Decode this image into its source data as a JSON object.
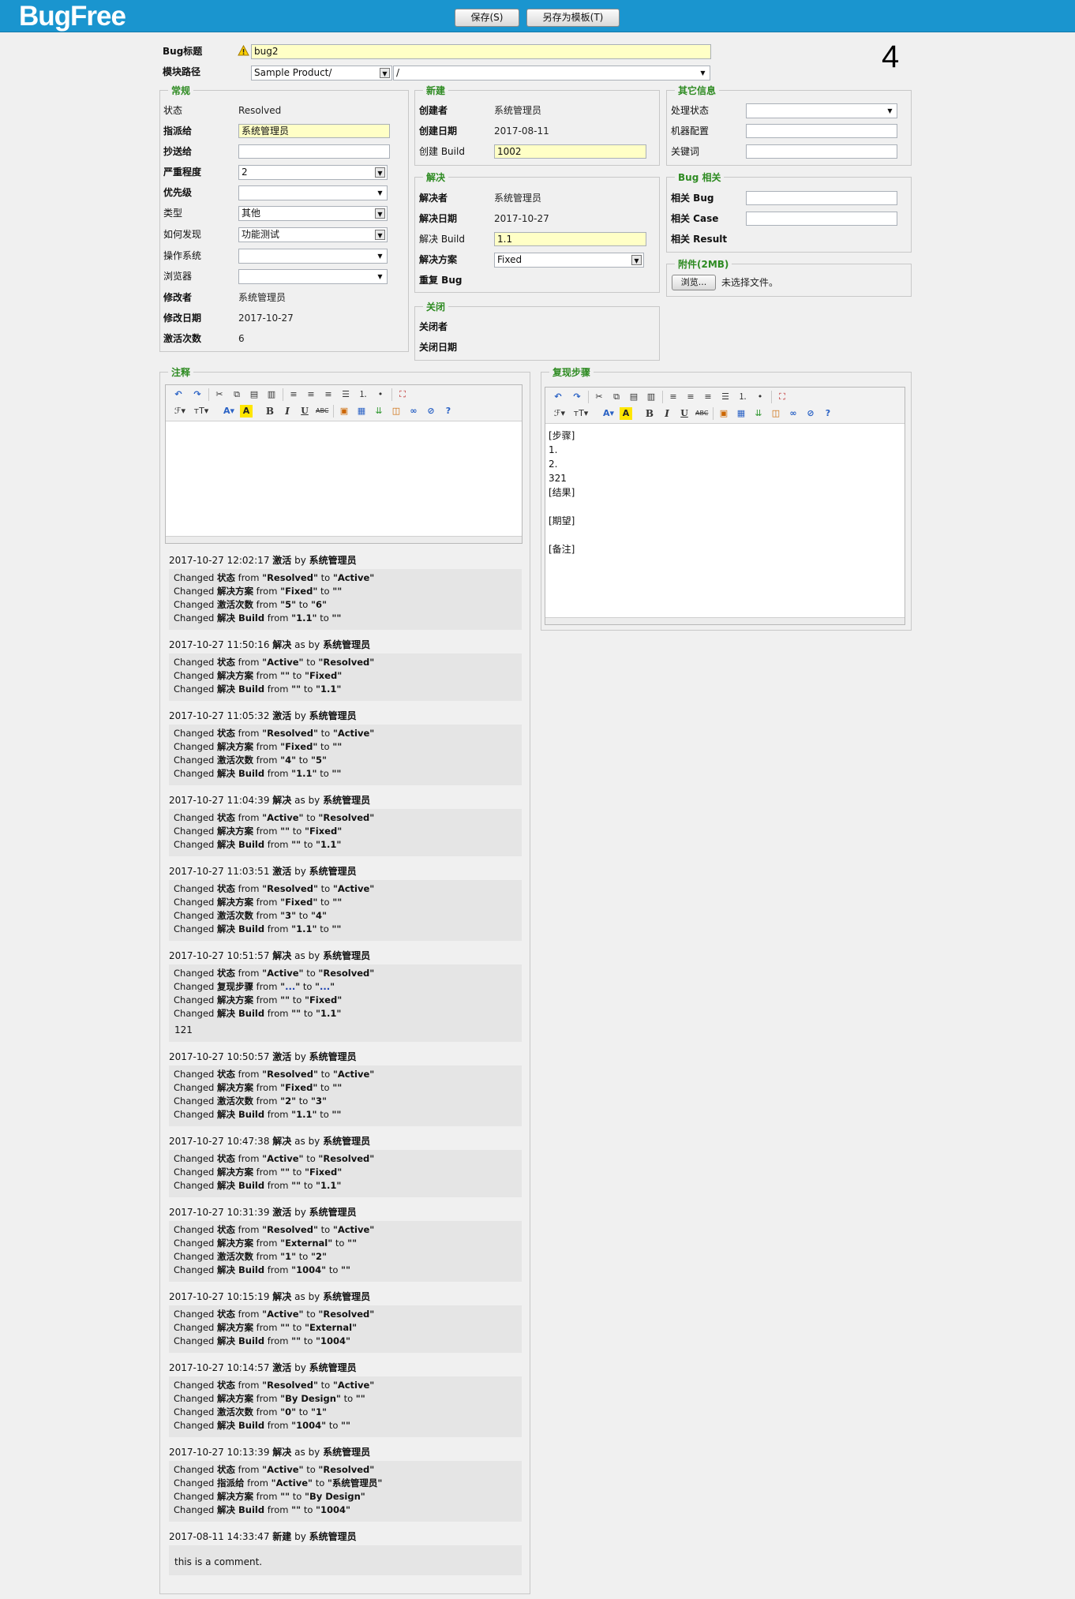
{
  "app": {
    "logo": "BugFree"
  },
  "toolbar": {
    "save": "保存(S)",
    "save_template": "另存为模板(T)"
  },
  "bug": {
    "id": "4",
    "title_label": "Bug标题",
    "title": "bug2",
    "module_label": "模块路径",
    "product": "Sample Product/",
    "module": "/"
  },
  "general": {
    "legend": "常规",
    "status_label": "状态",
    "status": "Resolved",
    "assigned_label": "指派给",
    "assigned": "系统管理员",
    "cc_label": "抄送给",
    "cc": "",
    "severity_label": "严重程度",
    "severity": "2",
    "priority_label": "优先级",
    "priority": "",
    "type_label": "类型",
    "type": "其他",
    "how_found_label": "如何发现",
    "how_found": "功能测试",
    "os_label": "操作系统",
    "os": "",
    "browser_label": "浏览器",
    "browser": "",
    "modified_by_label": "修改者",
    "modified_by": "系统管理员",
    "modified_date_label": "修改日期",
    "modified_date": "2017-10-27",
    "reopen_label": "激活次数",
    "reopen": "6"
  },
  "created": {
    "legend": "新建",
    "creator_label": "创建者",
    "creator": "系统管理员",
    "date_label": "创建日期",
    "date": "2017-08-11",
    "build_label": "创建 Build",
    "build": "1002"
  },
  "resolved": {
    "legend": "解决",
    "resolver_label": "解决者",
    "resolver": "系统管理员",
    "date_label": "解决日期",
    "date": "2017-10-27",
    "build_label": "解决 Build",
    "build": "1.1",
    "resolution_label": "解决方案",
    "resolution": "Fixed",
    "dup_label": "重复 Bug"
  },
  "closed": {
    "legend": "关闭",
    "closer_label": "关闭者",
    "date_label": "关闭日期"
  },
  "other": {
    "legend": "其它信息",
    "handle_label": "处理状态",
    "handle": "",
    "machine_label": "机器配置",
    "keyword_label": "关键词"
  },
  "related": {
    "legend": "Bug 相关",
    "bug_label": "相关 Bug",
    "case_label": "相关 Case",
    "result_label": "相关 Result"
  },
  "attach": {
    "legend": "附件(2MB)",
    "browse": "浏览...",
    "no_file": "未选择文件。"
  },
  "comment": {
    "legend": "注释"
  },
  "repro": {
    "legend": "复现步骤",
    "lines": [
      "[步骤]",
      "1.",
      "2.",
      "321",
      "[结果]",
      "",
      "[期望]",
      "",
      "[备注]"
    ]
  },
  "history": [
    {
      "time": "2017-10-27 12:02:17",
      "action": "激活",
      "as": "",
      "user": "系统管理员",
      "changes": [
        [
          "状态",
          "Resolved",
          "Active"
        ],
        [
          "解决方案",
          "Fixed",
          ""
        ],
        [
          "激活次数",
          "5",
          "6"
        ],
        [
          "解决 Build",
          "1.1",
          ""
        ]
      ]
    },
    {
      "time": "2017-10-27 11:50:16",
      "action": "解决",
      "as": "as",
      "user": "系统管理员",
      "changes": [
        [
          "状态",
          "Active",
          "Resolved"
        ],
        [
          "解决方案",
          "",
          "Fixed"
        ],
        [
          "解决 Build",
          "",
          "1.1"
        ]
      ]
    },
    {
      "time": "2017-10-27 11:05:32",
      "action": "激活",
      "as": "",
      "user": "系统管理员",
      "changes": [
        [
          "状态",
          "Resolved",
          "Active"
        ],
        [
          "解决方案",
          "Fixed",
          ""
        ],
        [
          "激活次数",
          "4",
          "5"
        ],
        [
          "解决 Build",
          "1.1",
          ""
        ]
      ]
    },
    {
      "time": "2017-10-27 11:04:39",
      "action": "解决",
      "as": "as",
      "user": "系统管理员",
      "changes": [
        [
          "状态",
          "Active",
          "Resolved"
        ],
        [
          "解决方案",
          "",
          "Fixed"
        ],
        [
          "解决 Build",
          "",
          "1.1"
        ]
      ]
    },
    {
      "time": "2017-10-27 11:03:51",
      "action": "激活",
      "as": "",
      "user": "系统管理员",
      "changes": [
        [
          "状态",
          "Resolved",
          "Active"
        ],
        [
          "解决方案",
          "Fixed",
          ""
        ],
        [
          "激活次数",
          "3",
          "4"
        ],
        [
          "解决 Build",
          "1.1",
          ""
        ]
      ]
    },
    {
      "time": "2017-10-27 10:51:57",
      "action": "解决",
      "as": "as",
      "user": "系统管理员",
      "changes": [
        [
          "状态",
          "Active",
          "Resolved"
        ],
        [
          "复现步骤",
          "...",
          "..."
        ],
        [
          "解决方案",
          "",
          "Fixed"
        ],
        [
          "解决 Build",
          "",
          "1.1"
        ]
      ],
      "comment": "121"
    },
    {
      "time": "2017-10-27 10:50:57",
      "action": "激活",
      "as": "",
      "user": "系统管理员",
      "changes": [
        [
          "状态",
          "Resolved",
          "Active"
        ],
        [
          "解决方案",
          "Fixed",
          ""
        ],
        [
          "激活次数",
          "2",
          "3"
        ],
        [
          "解决 Build",
          "1.1",
          ""
        ]
      ]
    },
    {
      "time": "2017-10-27 10:47:38",
      "action": "解决",
      "as": "as",
      "user": "系统管理员",
      "changes": [
        [
          "状态",
          "Active",
          "Resolved"
        ],
        [
          "解决方案",
          "",
          "Fixed"
        ],
        [
          "解决 Build",
          "",
          "1.1"
        ]
      ]
    },
    {
      "time": "2017-10-27 10:31:39",
      "action": "激活",
      "as": "",
      "user": "系统管理员",
      "changes": [
        [
          "状态",
          "Resolved",
          "Active"
        ],
        [
          "解决方案",
          "External",
          ""
        ],
        [
          "激活次数",
          "1",
          "2"
        ],
        [
          "解决 Build",
          "1004",
          ""
        ]
      ]
    },
    {
      "time": "2017-10-27 10:15:19",
      "action": "解决",
      "as": "as",
      "user": "系统管理员",
      "changes": [
        [
          "状态",
          "Active",
          "Resolved"
        ],
        [
          "解决方案",
          "",
          "External"
        ],
        [
          "解决 Build",
          "",
          "1004"
        ]
      ]
    },
    {
      "time": "2017-10-27 10:14:57",
      "action": "激活",
      "as": "",
      "user": "系统管理员",
      "changes": [
        [
          "状态",
          "Resolved",
          "Active"
        ],
        [
          "解决方案",
          "By Design",
          ""
        ],
        [
          "激活次数",
          "0",
          "1"
        ],
        [
          "解决 Build",
          "1004",
          ""
        ]
      ]
    },
    {
      "time": "2017-10-27 10:13:39",
      "action": "解决",
      "as": "as",
      "user": "系统管理员",
      "changes": [
        [
          "状态",
          "Active",
          "Resolved"
        ],
        [
          "指派给",
          "Active",
          "系统管理员"
        ],
        [
          "解决方案",
          "",
          "By Design"
        ],
        [
          "解决 Build",
          "",
          "1004"
        ]
      ]
    },
    {
      "time": "2017-08-11 14:33:47",
      "action": "新建",
      "as": "",
      "user": "系统管理员",
      "changes": [],
      "comment": "this is a comment."
    }
  ],
  "history_words": {
    "by": "by",
    "changed": "Changed",
    "from": "from",
    "to": "to"
  }
}
